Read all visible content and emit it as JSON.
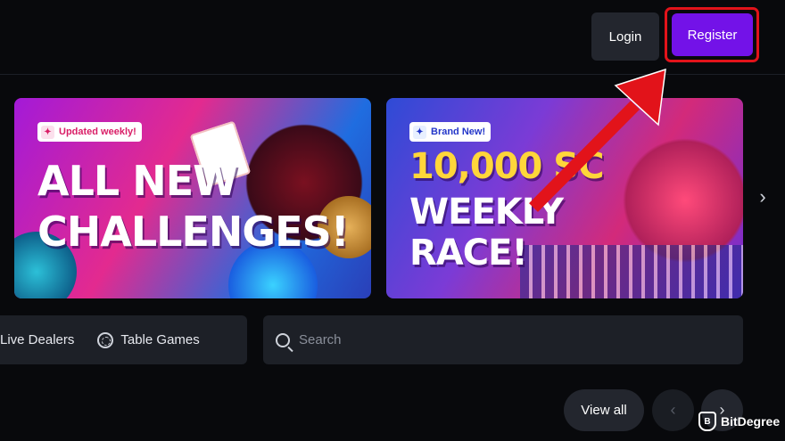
{
  "header": {
    "login_label": "Login",
    "register_label": "Register",
    "register_color": "#7312e8"
  },
  "banners": [
    {
      "tag": "Updated weekly!",
      "headline_lines": [
        "ALL NEW",
        "CHALLENGES!"
      ]
    },
    {
      "tag": "Brand New!",
      "headline_lines": [
        "10,000 SC",
        "WEEKLY",
        "RACE!"
      ]
    }
  ],
  "categories": [
    {
      "label": "Live Dealers"
    },
    {
      "label": "Table Games",
      "icon": "chip-icon"
    }
  ],
  "search": {
    "placeholder": "Search"
  },
  "pager": {
    "view_all_label": "View all"
  },
  "watermark": {
    "brand": "BitDegree"
  },
  "annotation": {
    "color": "#e2131a"
  }
}
